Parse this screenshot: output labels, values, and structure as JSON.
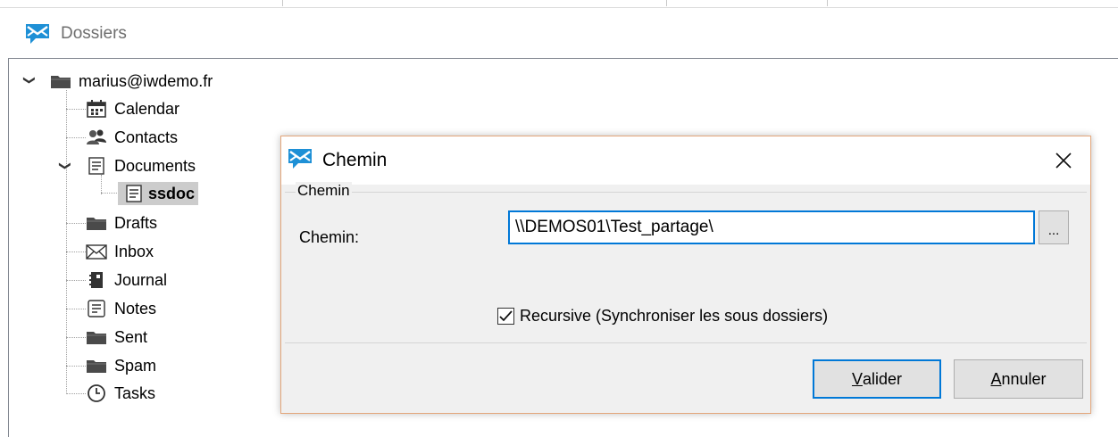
{
  "panel": {
    "title": "Dossiers"
  },
  "tree": {
    "root": "marius@iwdemo.fr",
    "items": [
      {
        "label": "Calendar",
        "icon": "calendar-icon"
      },
      {
        "label": "Contacts",
        "icon": "contacts-icon"
      },
      {
        "label": "Documents",
        "icon": "document-icon"
      },
      {
        "label": "ssdoc",
        "icon": "document-icon",
        "selected": true
      },
      {
        "label": "Drafts",
        "icon": "folder-icon"
      },
      {
        "label": "Inbox",
        "icon": "envelope-icon"
      },
      {
        "label": "Journal",
        "icon": "journal-icon"
      },
      {
        "label": "Notes",
        "icon": "note-icon"
      },
      {
        "label": "Sent",
        "icon": "folder-icon"
      },
      {
        "label": "Spam",
        "icon": "folder-icon"
      },
      {
        "label": "Tasks",
        "icon": "clock-icon"
      }
    ]
  },
  "dialog": {
    "title": "Chemin",
    "group_label": "Chemin",
    "field_label": "Chemin:",
    "path_value": "\\\\DEMOS01\\Test_partage\\",
    "browse_label": "...",
    "recursive_label": "Recursive (Synchroniser les sous dossiers)",
    "recursive_checked": true,
    "ok_rest": "alider",
    "ok_mnemonic": "V",
    "cancel_rest": "nnuler",
    "cancel_mnemonic": "A"
  },
  "colors": {
    "accent": "#0078d7",
    "selection": "#cccccc",
    "logo": "#1e90d6",
    "dialog_border": "#e3a67a"
  }
}
